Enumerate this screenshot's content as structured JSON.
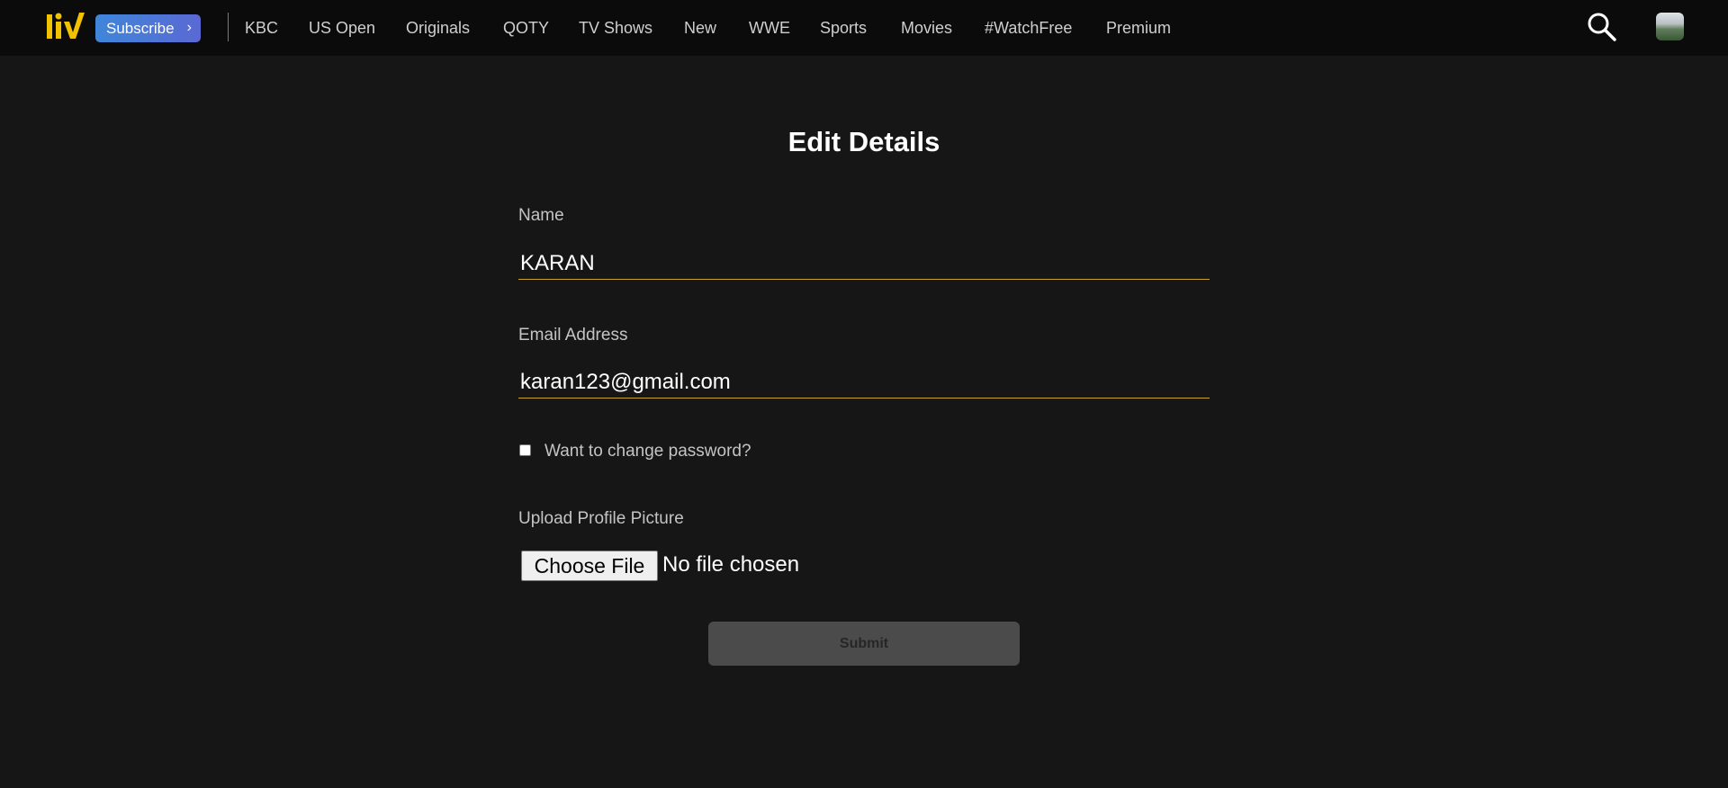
{
  "header": {
    "logo_icon": "liv-logo-icon",
    "subscribe_label": "Subscribe",
    "subscribe_chevron": "›",
    "accent_color": "#f2c200",
    "nav": [
      {
        "label": "KBC"
      },
      {
        "label": "US Open"
      },
      {
        "label": "Originals"
      },
      {
        "label": "QOTY"
      },
      {
        "label": "TV Shows"
      },
      {
        "label": "New"
      },
      {
        "label": "WWE"
      },
      {
        "label": "Sports"
      },
      {
        "label": "Movies"
      },
      {
        "label": "#WatchFree"
      },
      {
        "label": "Premium"
      }
    ],
    "search_icon": "search-icon",
    "avatar_icon": "avatar"
  },
  "form": {
    "title": "Edit Details",
    "name_label": "Name",
    "name_value": "KARAN",
    "email_label": "Email Address",
    "email_value": "karan123@gmail.com",
    "password_checkbox_label": "Want to change password?",
    "password_checkbox_checked": false,
    "upload_label": "Upload Profile Picture",
    "choose_file_label": "Choose File",
    "file_status": "No file chosen",
    "submit_label": "Submit",
    "underline_color": "#c9a227"
  }
}
